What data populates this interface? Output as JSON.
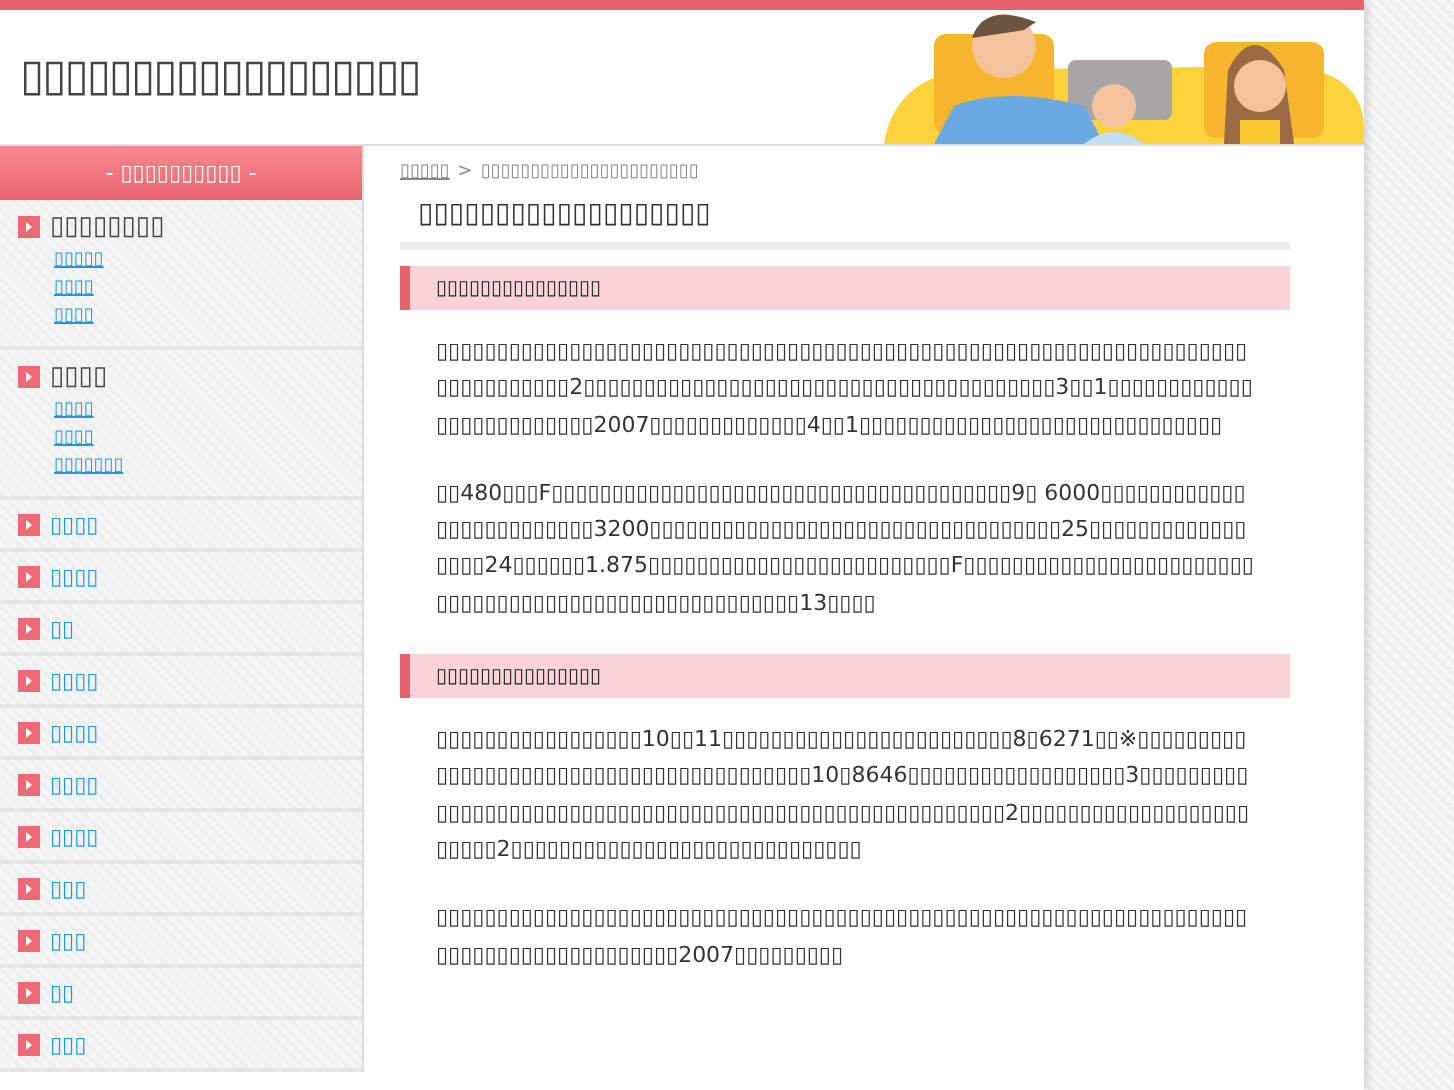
{
  "site_title": "▯▯▯▯▯▯▯▯▯▯▯▯▯▯▯▯▯▯",
  "sidebar": {
    "heading": "- ▯▯▯▯▯▯▯▯▯▯ -",
    "sections": [
      {
        "title": "▯▯▯▯▯▯▯▯",
        "links": [
          "▯▯▯▯▯",
          "▯▯▯▯",
          "▯▯▯▯"
        ]
      },
      {
        "title": "▯▯▯▯",
        "links": [
          "▯▯▯▯",
          "▯▯▯▯",
          "▯▯▯▯▯▯▯"
        ]
      }
    ],
    "items": [
      "▯▯▯▯",
      "▯▯▯▯",
      "▯▯",
      "▯▯▯▯",
      "▯▯▯▯",
      "▯▯▯▯",
      "▯▯▯▯",
      "▯▯▯",
      "▯▯▯",
      "▯▯",
      "▯▯▯"
    ]
  },
  "breadcrumb": {
    "items": [
      "▯▯▯▯▯",
      "▯▯▯▯▯▯▯▯▯▯▯▯▯▯▯▯▯▯▯▯▯▯"
    ],
    "separator": ">"
  },
  "page_title": "▯▯▯▯▯▯▯▯▯▯▯▯▯▯▯▯▯▯▯",
  "sections": [
    {
      "heading": "▯▯▯▯▯▯▯▯▯▯▯▯▯▯▯",
      "paragraphs": [
        "▯▯▯▯▯▯▯▯▯▯▯▯▯▯▯▯▯▯▯▯▯▯▯▯▯▯▯▯▯▯▯▯▯▯▯▯▯▯▯▯▯▯▯▯▯▯▯▯▯▯▯▯▯▯▯▯▯▯▯▯▯▯▯▯▯▯▯▯▯▯▯▯▯▯▯▯▯▯2▯▯▯▯▯▯▯▯▯▯▯▯▯▯▯▯▯▯▯▯▯▯▯▯▯▯▯▯▯▯▯▯▯▯▯▯▯▯▯3▯▯1▯▯▯▯▯▯▯▯▯▯▯▯▯▯▯▯▯▯▯▯▯▯▯▯▯2007▯▯▯▯▯▯▯▯▯▯▯▯▯4▯▯1▯▯▯▯▯▯▯▯▯▯▯▯▯▯▯▯▯▯▯▯▯▯▯▯▯▯▯▯▯▯",
        "▯▯480▯▯▯F▯▯▯▯▯▯▯▯▯▯▯▯▯▯▯▯▯▯▯▯▯▯▯▯▯▯▯▯▯▯▯▯▯▯▯▯▯▯9▯ 6000▯▯▯▯▯▯▯▯▯▯▯▯▯▯▯▯▯▯▯▯▯▯▯▯▯3200▯▯▯▯▯▯▯▯▯▯▯▯▯▯▯▯▯▯▯▯▯▯▯▯▯▯▯▯▯▯▯▯▯▯25▯▯▯▯▯▯▯▯▯▯▯▯▯▯▯▯▯24▯▯▯▯▯▯1.875▯▯▯▯▯▯▯▯▯▯▯▯▯▯▯▯▯▯▯▯▯▯▯▯▯F▯▯▯▯▯▯▯▯▯▯▯▯▯▯▯▯▯▯▯▯▯▯▯▯▯▯▯▯▯▯▯▯▯▯▯▯▯▯▯▯▯▯▯▯▯▯▯▯▯▯▯▯▯▯13▯▯▯▯"
      ]
    },
    {
      "heading": "▯▯▯▯▯▯▯▯▯▯▯▯▯▯▯",
      "paragraphs": [
        "▯▯▯▯▯▯▯▯▯▯▯▯▯▯▯▯▯10▯▯11▯▯▯▯▯▯▯▯▯▯▯▯▯▯▯▯▯▯▯▯▯▯▯▯8▯6271▯▯※▯▯▯▯▯▯▯▯▯▯▯▯▯▯▯▯▯▯▯▯▯▯▯▯▯▯▯▯▯▯▯▯▯▯▯▯▯▯▯▯10▯8646▯▯▯▯▯▯▯▯▯▯▯▯▯▯▯▯▯▯3▯▯▯▯▯▯▯▯▯▯▯▯▯▯▯▯▯▯▯▯▯▯▯▯▯▯▯▯▯▯▯▯▯▯▯▯▯▯▯▯▯▯▯▯▯▯▯▯▯▯▯▯▯▯▯▯2▯▯▯▯▯▯▯▯▯▯▯▯▯▯▯▯▯▯▯▯▯▯▯▯2▯▯▯▯▯▯▯▯▯▯▯▯▯▯▯▯▯▯▯▯▯▯▯▯▯▯▯▯▯",
        "▯▯▯▯▯▯▯▯▯▯▯▯▯▯▯▯▯▯▯▯▯▯▯▯▯▯▯▯▯▯▯▯▯▯▯▯▯▯▯▯▯▯▯▯▯▯▯▯▯▯▯▯▯▯▯▯▯▯▯▯▯▯▯▯▯▯▯▯▯▯▯▯▯▯▯▯▯▯▯▯▯▯▯▯▯▯▯2007▯▯▯▯▯▯▯▯▯"
      ]
    }
  ]
}
